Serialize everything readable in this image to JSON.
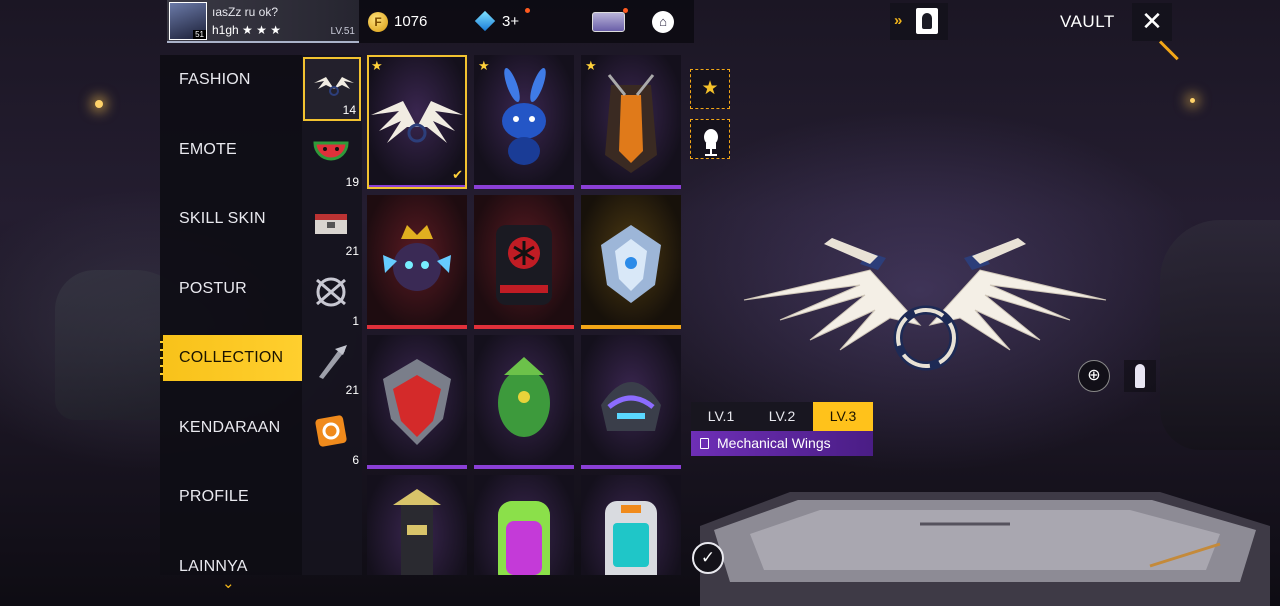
{
  "header": {
    "player_name": "ıasZz   ru    ok?",
    "player_tag": "h1gh ★ ★ ★",
    "player_level": "LV.51",
    "avatar_badge": "51",
    "coins": "1076",
    "coin_symbol": "F",
    "diamonds": "3+",
    "vault_title": "VAULT"
  },
  "menu": {
    "items": [
      {
        "label": "FASHION"
      },
      {
        "label": "EMOTE"
      },
      {
        "label": "SKILL SKIN"
      },
      {
        "label": "POSTUR"
      },
      {
        "label": "COLLECTION"
      },
      {
        "label": "KENDARAAN"
      },
      {
        "label": "PROFILE"
      },
      {
        "label": "LAINNYA"
      }
    ],
    "active": "COLLECTION"
  },
  "categories": [
    {
      "icon": "wings-icon",
      "count": "14"
    },
    {
      "icon": "watermelon-icon",
      "count": "19"
    },
    {
      "icon": "chest-icon",
      "count": "21"
    },
    {
      "icon": "gear-emblem-icon",
      "count": "1"
    },
    {
      "icon": "weapon-icon",
      "count": "21"
    },
    {
      "icon": "sticker-icon",
      "count": "6"
    }
  ],
  "details": {
    "levels": [
      "LV.1",
      "LV.2",
      "LV.3"
    ],
    "active_level": "LV.3",
    "item_name": "Mechanical Wings"
  },
  "colors": {
    "accent_gold": "#ffc21b",
    "rarity_purple": "#8a3fd6",
    "rarity_red": "#e0303a",
    "rarity_gold": "#f2a617"
  }
}
